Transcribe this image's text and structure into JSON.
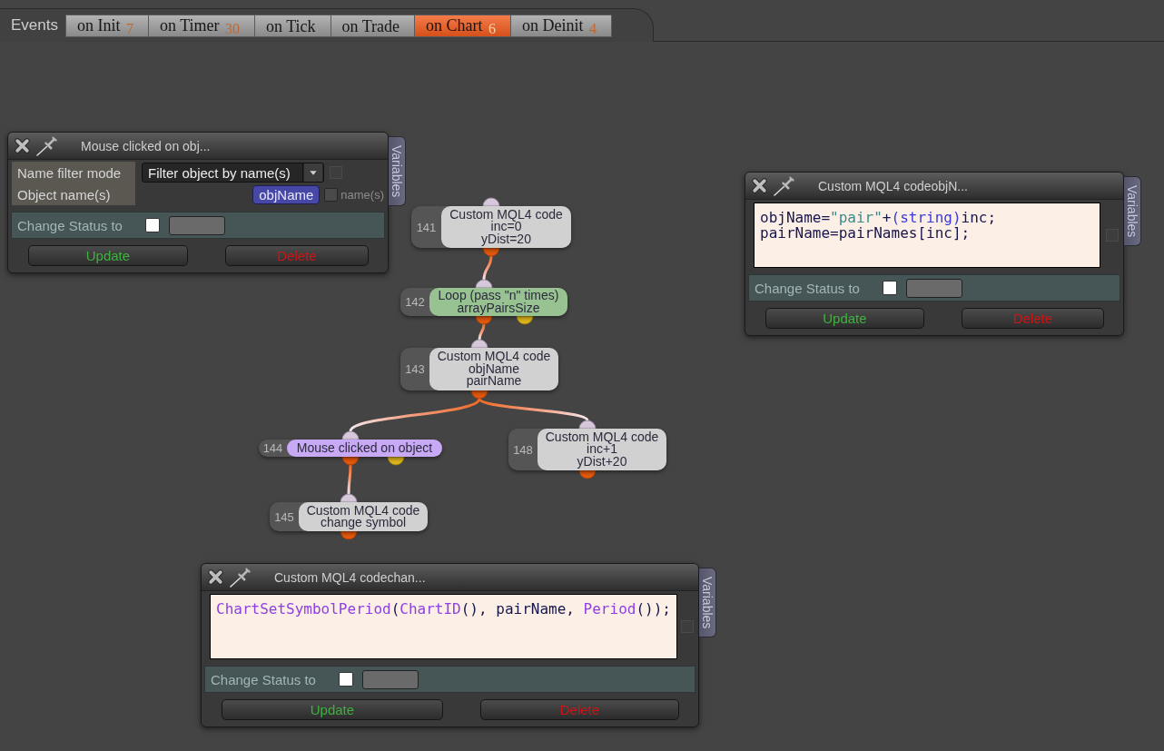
{
  "events_bar": {
    "label": "Events",
    "tabs": [
      {
        "label": "on Init",
        "count": "7",
        "selected": false
      },
      {
        "label": "on Timer",
        "count": "30",
        "selected": false
      },
      {
        "label": "on Tick",
        "selected": false
      },
      {
        "label": "on Trade",
        "selected": false
      },
      {
        "label": "on Chart",
        "count": "6",
        "selected": true
      },
      {
        "label": "on Deinit",
        "count": "4",
        "selected": false
      }
    ]
  },
  "windows": [
    {
      "kind": "event",
      "title": "Mouse clicked on obj...",
      "side_tab": "Variables",
      "fields": [
        {
          "kind": "dropdown",
          "label": "Name filter mode",
          "value": "Filter object by name(s)",
          "checkbox": {
            "checked": false
          }
        },
        {
          "kind": "variables",
          "label": "Object name(s)",
          "chips": [
            "objName"
          ],
          "checkbox": {
            "checked": false,
            "label": "name(s)"
          }
        }
      ],
      "status": {
        "label": "Change Status to",
        "checked": false
      },
      "buttons": [
        {
          "kind": "update",
          "label": "Update"
        },
        {
          "kind": "delete",
          "label": "Delete"
        }
      ]
    },
    {
      "kind": "code",
      "title": "Custom MQL4 codeobjN...",
      "side_tab": "Variables",
      "code": [
        {
          "tokens": [
            {
              "kind": "plain",
              "text": "objName="
            },
            {
              "kind": "string",
              "text": "\"pair\""
            },
            {
              "kind": "plain",
              "text": "+"
            },
            {
              "kind": "keyword",
              "text": "(string)"
            },
            {
              "kind": "plain",
              "text": "inc;"
            }
          ]
        },
        {
          "tokens": [
            {
              "kind": "plain",
              "text": "pairName=pairNames[inc];"
            }
          ]
        }
      ],
      "checkbox": {
        "checked": false
      },
      "status": {
        "label": "Change Status to",
        "checked": false
      },
      "buttons": [
        {
          "kind": "update",
          "label": "Update"
        },
        {
          "kind": "delete",
          "label": "Delete"
        }
      ]
    },
    {
      "kind": "code",
      "title": "Custom MQL4 codechan...",
      "side_tab": "Variables",
      "code": [
        {
          "tokens": [
            {
              "kind": "function",
              "text": "ChartSetSymbolPeriod"
            },
            {
              "kind": "plain",
              "text": "("
            },
            {
              "kind": "function",
              "text": "ChartID"
            },
            {
              "kind": "plain",
              "text": "(), pairName, "
            },
            {
              "kind": "function",
              "text": "Period"
            },
            {
              "kind": "plain",
              "text": "());"
            }
          ]
        }
      ],
      "checkbox": {
        "checked": false
      },
      "status": {
        "label": "Change Status to",
        "checked": false
      },
      "buttons": [
        {
          "kind": "update",
          "label": "Update"
        },
        {
          "kind": "delete",
          "label": "Delete"
        }
      ]
    }
  ],
  "flow": {
    "nodes": [
      {
        "number": "141",
        "kind": "code",
        "lines": [
          "Custom MQL4 code",
          "inc=0",
          "yDist=20"
        ],
        "children": [
          {
            "number": "142",
            "kind": "loop",
            "lines": [
              "Loop (pass \"n\" times)",
              "arrayPairsSize"
            ],
            "children": [
              {
                "number": "143",
                "kind": "code",
                "lines": [
                  "Custom MQL4 code",
                  "objName",
                  "pairName"
                ],
                "children": [
                  {
                    "number": "144",
                    "kind": "event",
                    "lines": [
                      "Mouse clicked on object"
                    ],
                    "children": [
                      {
                        "number": "145",
                        "kind": "code",
                        "lines": [
                          "Custom MQL4 code",
                          "change symbol"
                        ]
                      }
                    ]
                  },
                  {
                    "number": "148",
                    "kind": "code",
                    "lines": [
                      "Custom MQL4 code",
                      "inc+1",
                      "yDist+20"
                    ]
                  }
                ]
              }
            ]
          }
        ]
      }
    ]
  }
}
